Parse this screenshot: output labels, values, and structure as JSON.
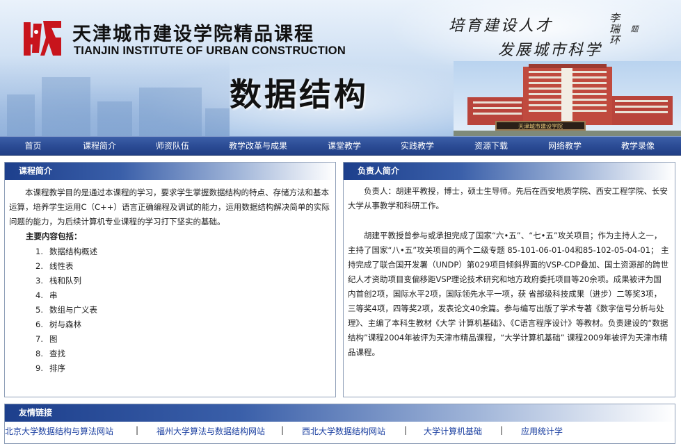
{
  "header": {
    "school_name_cn": "天津城市建设学院精品课程",
    "school_name_en": "TIANJIN INSTITUTE OF URBAN CONSTRUCTION",
    "motto_line1": "培育建设人才",
    "motto_line2": "发展城市科学",
    "signature_name": "李瑞环",
    "signature_note": "题",
    "course_title": "数据结构",
    "building_sign": "天津城市建设学院"
  },
  "nav": [
    "首页",
    "课程简介",
    "师资队伍",
    "教学改革与成果",
    "课堂教学",
    "实践教学",
    "资源下载",
    "网络教学",
    "教学录像"
  ],
  "course_intro": {
    "heading": "课程简介",
    "paragraph": "本课程教学目的是通过本课程的学习，要求学生掌握数据结构的特点、存储方法和基本运算，培养学生运用C（C++）语言正确编程及调试的能力，运用数据结构解决简单的实际问题的能力，为后续计算机专业课程的学习打下坚实的基础。",
    "main_label": "主要内容包括：",
    "topics": [
      {
        "num": "1.",
        "label": "数据结构概述"
      },
      {
        "num": "2.",
        "label": "线性表"
      },
      {
        "num": "3.",
        "label": "栈和队列"
      },
      {
        "num": "4.",
        "label": "串"
      },
      {
        "num": "5.",
        "label": "数组与广义表"
      },
      {
        "num": "6.",
        "label": "树与森林"
      },
      {
        "num": "7.",
        "label": "图"
      },
      {
        "num": "8.",
        "label": "查找"
      },
      {
        "num": "9.",
        "label": "排序"
      }
    ]
  },
  "leader_intro": {
    "heading": "负责人简介",
    "paragraph1": "负责人：胡建平教授，博士，硕士生导师。先后在西安地质学院、西安工程学院、长安大学从事教学和科研工作。",
    "paragraph2": "胡建平教授曾参与或承担完成了国家“六•五”、“七•五”攻关项目；作为主持人之一，主持了国家“八•五”攻关项目的两个二级专题 85-101-06-01-04和85-102-05-04-01； 主持完成了联合国开发署（UNDP）第029项目倾斜界面的VSP-CDP叠加、国土资源部的跨世纪人才资助项目变偏移距VSP理论技术研究和地方政府委托项目等20余项。成果被评为国内首创2项，国际水平2项，国际领先水平一项，获 省部级科技成果（进步）二等奖3项，三等奖4项，四等奖2项，发表论文40余篇。参与编写出版了学术专著《数字信号分析与处理》、主编了本科生教材《大学 计算机基础》、《C语言程序设计》等教材。负责建设的“数据结构”课程2004年被评为天津市精品课程，“大学计算机基础” 课程2009年被评为天津市精品课程。"
  },
  "links": {
    "heading": "友情链接",
    "items": [
      "北京大学数据结构与算法网站",
      "福州大学算法与数据结构网站",
      "西北大学数据结构网站",
      "大学计算机基础",
      "应用统计学"
    ],
    "separator": "|"
  },
  "colors": {
    "nav_bg": "#2a4a93",
    "panel_head": "#1d3f8c",
    "link": "#1a3fa0",
    "logo_red": "#c8141c"
  }
}
